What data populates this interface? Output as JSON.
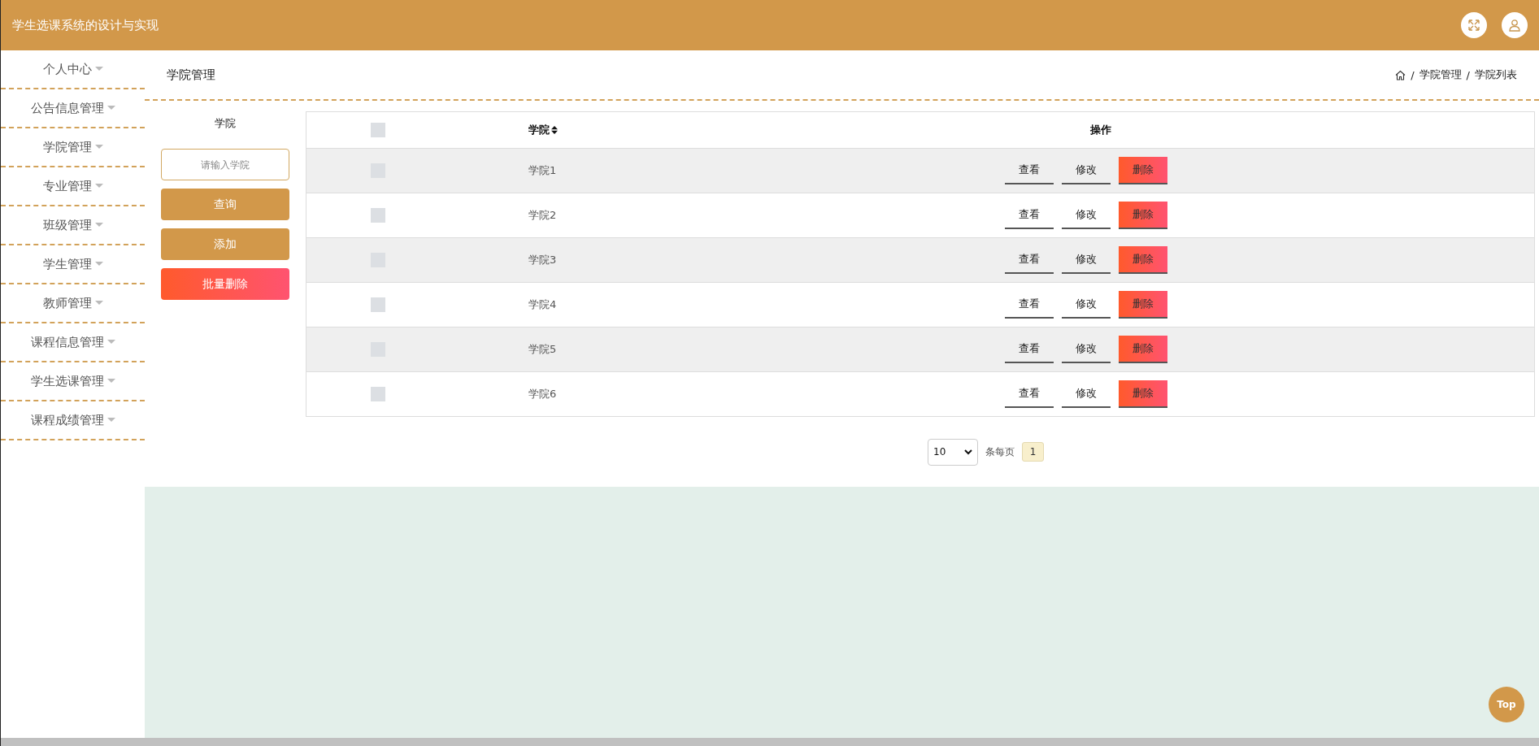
{
  "header": {
    "title": "学生选课系统的设计与实现"
  },
  "sidebar": {
    "items": [
      {
        "label": "个人中心"
      },
      {
        "label": "公告信息管理"
      },
      {
        "label": "学院管理"
      },
      {
        "label": "专业管理"
      },
      {
        "label": "班级管理"
      },
      {
        "label": "学生管理"
      },
      {
        "label": "教师管理"
      },
      {
        "label": "课程信息管理"
      },
      {
        "label": "学生选课管理"
      },
      {
        "label": "课程成绩管理"
      }
    ]
  },
  "breadcrumb": {
    "title": "学院管理",
    "separator": "/",
    "path": [
      "学院管理",
      "学院列表"
    ]
  },
  "search": {
    "label": "学院",
    "placeholder": "请输入学院",
    "buttons": [
      {
        "label": "查询",
        "kind": "primary"
      },
      {
        "label": "添加",
        "kind": "primary"
      },
      {
        "label": "批量删除",
        "kind": "danger"
      }
    ]
  },
  "table": {
    "select_all": {
      "checked": false
    },
    "columns": [
      "学院",
      "操作"
    ],
    "rows": [
      {
        "checked": false,
        "name": "学院1",
        "actions": [
          {
            "label": "查看",
            "kind": "link"
          },
          {
            "label": "修改",
            "kind": "link"
          },
          {
            "label": "删除",
            "kind": "danger"
          }
        ]
      },
      {
        "checked": false,
        "name": "学院2",
        "actions": [
          {
            "label": "查看",
            "kind": "link"
          },
          {
            "label": "修改",
            "kind": "link"
          },
          {
            "label": "删除",
            "kind": "danger"
          }
        ]
      },
      {
        "checked": false,
        "name": "学院3",
        "actions": [
          {
            "label": "查看",
            "kind": "link"
          },
          {
            "label": "修改",
            "kind": "link"
          },
          {
            "label": "删除",
            "kind": "danger"
          }
        ]
      },
      {
        "checked": false,
        "name": "学院4",
        "actions": [
          {
            "label": "查看",
            "kind": "link"
          },
          {
            "label": "修改",
            "kind": "link"
          },
          {
            "label": "删除",
            "kind": "danger"
          }
        ]
      },
      {
        "checked": false,
        "name": "学院5",
        "actions": [
          {
            "label": "查看",
            "kind": "link"
          },
          {
            "label": "修改",
            "kind": "link"
          },
          {
            "label": "删除",
            "kind": "danger"
          }
        ]
      },
      {
        "checked": false,
        "name": "学院6",
        "actions": [
          {
            "label": "查看",
            "kind": "link"
          },
          {
            "label": "修改",
            "kind": "link"
          },
          {
            "label": "删除",
            "kind": "danger"
          }
        ]
      }
    ]
  },
  "pagination": {
    "page_size": "10",
    "size_label": "条每页",
    "pages": [
      {
        "label": "1",
        "selected": true
      }
    ]
  },
  "back_to_top": "Top"
}
